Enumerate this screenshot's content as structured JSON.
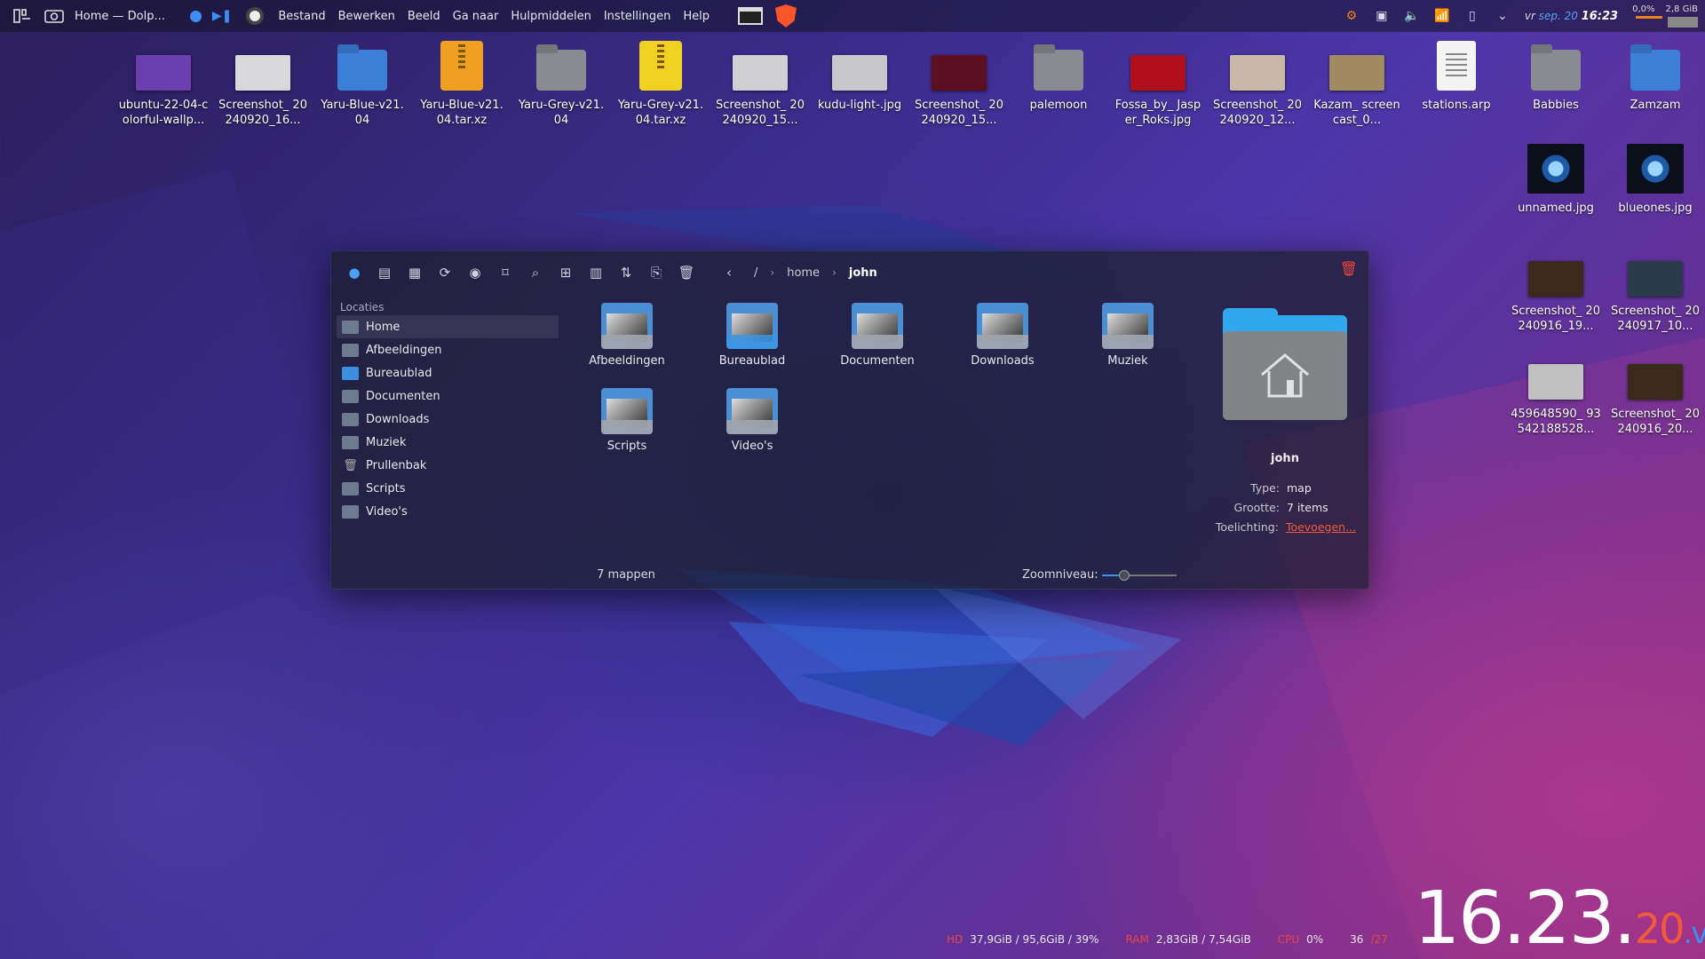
{
  "panel": {
    "window_title": "Home — Dolp...",
    "menu": [
      "Bestand",
      "Bewerken",
      "Beeld",
      "Ga naar",
      "Hulpmiddelen",
      "Instellingen",
      "Help"
    ],
    "date_day": "vr",
    "date": "sep. 20",
    "time": "16:23",
    "cpu": "0,0%",
    "mem": "2,8 GiB"
  },
  "desktop": {
    "top_row": [
      {
        "label": "ubuntu-22-04-colorful-wallp...",
        "kind": "img",
        "color": "#6b3fb0"
      },
      {
        "label": "Screenshot_ 20240920_16...",
        "kind": "img",
        "color": "#d8d8dc"
      },
      {
        "label": "Yaru-Blue-v21. 04",
        "kind": "folder",
        "color": "#3c7fd8"
      },
      {
        "label": "Yaru-Blue-v21. 04.tar.xz",
        "kind": "zip",
        "color": "#f0a020"
      },
      {
        "label": "Yaru-Grey-v21. 04",
        "kind": "folder",
        "color": "#8a8a92"
      },
      {
        "label": "Yaru-Grey-v21. 04.tar.xz",
        "kind": "zip",
        "color": "#f0d020"
      },
      {
        "label": "Screenshot_ 20240920_15...",
        "kind": "img",
        "color": "#d0d0d4"
      },
      {
        "label": "kudu-light-.jpg",
        "kind": "img",
        "color": "#c8c8cc"
      },
      {
        "label": "Screenshot_ 20240920_15...",
        "kind": "img",
        "color": "#5a1020"
      },
      {
        "label": "palemoon",
        "kind": "folder",
        "color": "#8a8a92"
      },
      {
        "label": "Fossa_by_ Jasper_Roks.jpg",
        "kind": "img",
        "color": "#b0101c"
      },
      {
        "label": "Screenshot_ 20240920_12...",
        "kind": "img",
        "color": "#c8b8a8"
      },
      {
        "label": "Kazam_ screencast_0...",
        "kind": "img",
        "color": "#a08a60"
      },
      {
        "label": "stations.arp",
        "kind": "doc",
        "color": "#f4f4f4"
      },
      {
        "label": "Babbies",
        "kind": "folder",
        "color": "#8a8a92"
      },
      {
        "label": "Zamzam",
        "kind": "folder",
        "color": "#3c7fd8"
      }
    ],
    "right_col": [
      {
        "label": "unnamed.jpg",
        "kind": "eye",
        "color": "#1d5aa8"
      },
      {
        "label": "blueones.jpg",
        "kind": "eye",
        "color": "#1d5aa8"
      },
      {
        "label": "Screenshot_ 20240916_19...",
        "kind": "img",
        "color": "#3a2a1a"
      },
      {
        "label": "Screenshot_ 20240917_10...",
        "kind": "img",
        "color": "#2a3a4a"
      },
      {
        "label": "459648590_ 93542188528...",
        "kind": "img",
        "color": "#c0c0c0"
      },
      {
        "label": "Screenshot_ 20240916_20...",
        "kind": "img",
        "color": "#3a2a1a"
      }
    ]
  },
  "dolphin": {
    "breadcrumb": [
      "/",
      "home",
      "john"
    ],
    "places_heading": "Locaties",
    "places": [
      {
        "label": "Home",
        "icon": "folder",
        "active": true
      },
      {
        "label": "Afbeeldingen",
        "icon": "folder"
      },
      {
        "label": "Bureaublad",
        "icon": "folder-blue"
      },
      {
        "label": "Documenten",
        "icon": "folder"
      },
      {
        "label": "Downloads",
        "icon": "folder"
      },
      {
        "label": "Muziek",
        "icon": "folder"
      },
      {
        "label": "Prullenbak",
        "icon": "trash"
      },
      {
        "label": "Scripts",
        "icon": "folder"
      },
      {
        "label": "Video's",
        "icon": "folder"
      }
    ],
    "files": [
      {
        "label": "Afbeeldingen",
        "blue": false
      },
      {
        "label": "Bureaublad",
        "blue": true
      },
      {
        "label": "Documenten",
        "blue": false
      },
      {
        "label": "Downloads",
        "blue": false
      },
      {
        "label": "Muziek",
        "blue": false
      },
      {
        "label": "Scripts",
        "blue": false
      },
      {
        "label": "Video's",
        "blue": false
      }
    ],
    "info": {
      "name": "john",
      "type_label": "Type:",
      "type_value": "map",
      "size_label": "Grootte:",
      "size_value": "7 items",
      "comment_label": "Toelichting:",
      "comment_link": "Toevoegen..."
    },
    "status_count": "7 mappen",
    "zoom_label": "Zoomniveau:",
    "zoom_level": 0.3
  },
  "bottom": {
    "hd_label": "HD",
    "hd_value": "37,9GiB / 95,6GiB / 39%",
    "ram_label": "RAM",
    "ram_value": "2,83GiB / 7,54GiB",
    "cpu_label": "CPU",
    "cpu_value": "0%",
    "temp_value": "36",
    "temp_extra": "/27",
    "clock_big": "16.23.",
    "clock_sec": "20",
    "clock_day": ".vr"
  }
}
